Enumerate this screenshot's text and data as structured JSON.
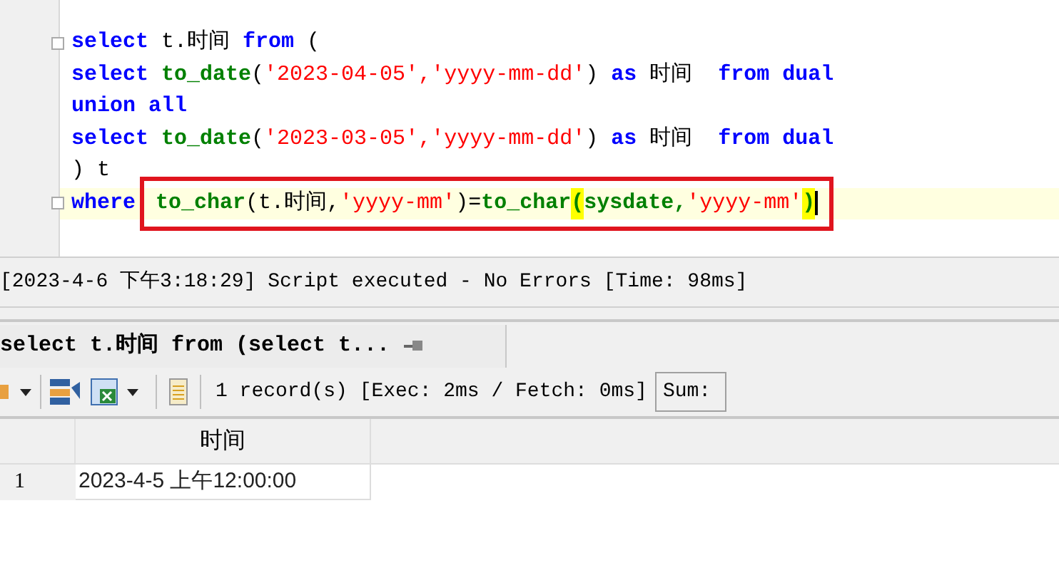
{
  "editor": {
    "lines": [
      {
        "fold": true,
        "current": false,
        "tokens": [
          {
            "text": "select",
            "kind": "keyword"
          },
          {
            "text": " t.时间 ",
            "kind": "plain"
          },
          {
            "text": "from",
            "kind": "keyword"
          },
          {
            "text": " (",
            "kind": "plain"
          }
        ]
      },
      {
        "fold": false,
        "current": false,
        "tokens": [
          {
            "text": "select ",
            "kind": "keyword"
          },
          {
            "text": "to_date",
            "kind": "function"
          },
          {
            "text": "(",
            "kind": "plain"
          },
          {
            "text": "'2023-04-05','yyyy-mm-dd'",
            "kind": "string"
          },
          {
            "text": ") ",
            "kind": "plain"
          },
          {
            "text": "as",
            "kind": "keyword"
          },
          {
            "text": " 时间  ",
            "kind": "plain"
          },
          {
            "text": "from dual",
            "kind": "keyword"
          }
        ]
      },
      {
        "fold": false,
        "current": false,
        "tokens": [
          {
            "text": "union all",
            "kind": "keyword"
          }
        ]
      },
      {
        "fold": false,
        "current": false,
        "tokens": [
          {
            "text": "select ",
            "kind": "keyword"
          },
          {
            "text": "to_date",
            "kind": "function"
          },
          {
            "text": "(",
            "kind": "plain"
          },
          {
            "text": "'2023-03-05','yyyy-mm-dd'",
            "kind": "string"
          },
          {
            "text": ") ",
            "kind": "plain"
          },
          {
            "text": "as",
            "kind": "keyword"
          },
          {
            "text": " 时间  ",
            "kind": "plain"
          },
          {
            "text": "from dual",
            "kind": "keyword"
          }
        ]
      },
      {
        "fold": false,
        "current": false,
        "tokens": [
          {
            "text": ") t",
            "kind": "plain"
          }
        ]
      },
      {
        "fold": true,
        "current": true,
        "tokens": [
          {
            "text": "where",
            "kind": "keyword"
          }
        ],
        "boxed_tokens": [
          {
            "text": "to_char",
            "kind": "function"
          },
          {
            "text": "(t.时间,",
            "kind": "plain"
          },
          {
            "text": "'yyyy-mm'",
            "kind": "string"
          },
          {
            "text": ")=",
            "kind": "plain"
          },
          {
            "text": "to_char",
            "kind": "function"
          },
          {
            "text": "(",
            "kind": "match"
          },
          {
            "text": "sysdate,",
            "kind": "function"
          },
          {
            "text": "'yyyy-mm'",
            "kind": "string"
          },
          {
            "text": ")",
            "kind": "match"
          }
        ]
      }
    ]
  },
  "message": "[2023-4-6 下午3:18:29] Script executed - No Errors [Time: 98ms]",
  "result_tab": {
    "label": "select t.时间 from (select t...",
    "selected": true
  },
  "toolbar": {
    "record_info": "1 record(s) [Exec: 2ms / Fetch: 0ms]",
    "sum_label": "Sum:"
  },
  "grid": {
    "columns": [
      "时间"
    ],
    "rows": [
      {
        "number": "1",
        "cells": [
          "2023-4-5 上午12:00:00"
        ]
      }
    ]
  }
}
